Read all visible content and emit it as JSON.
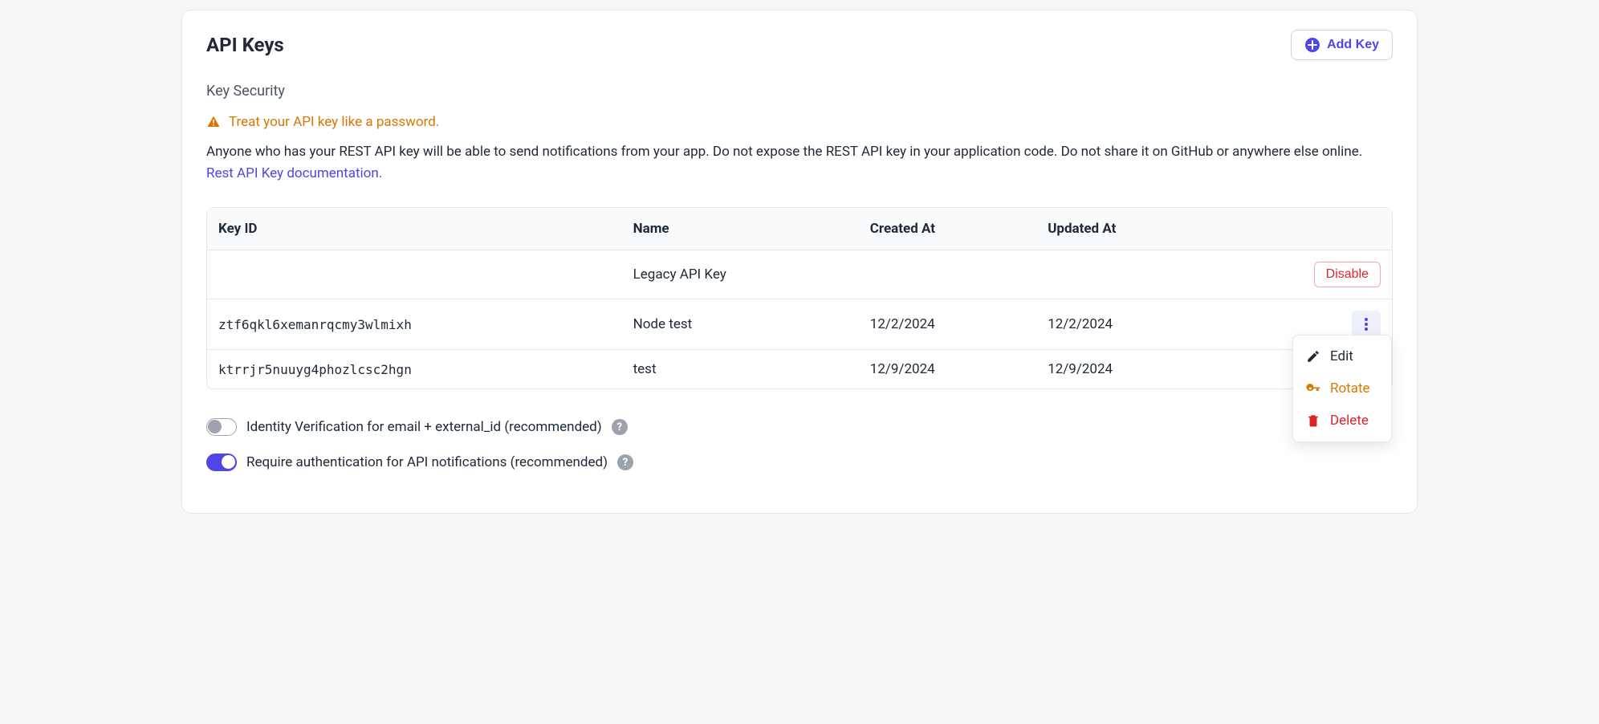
{
  "header": {
    "title": "API Keys",
    "add_key_label": "Add Key"
  },
  "security": {
    "heading": "Key Security",
    "warning": "Treat your API key like a password.",
    "description": "Anyone who has your REST API key will be able to send notifications from your app. Do not expose the REST API key in your application code. Do not share it on GitHub or anywhere else online. ",
    "doc_link_text": "Rest API Key documentation."
  },
  "table": {
    "columns": {
      "key_id": "Key ID",
      "name": "Name",
      "created_at": "Created At",
      "updated_at": "Updated At"
    },
    "rows": [
      {
        "key_id": "",
        "name": "Legacy API Key",
        "created_at": "",
        "updated_at": "",
        "action": "disable"
      },
      {
        "key_id": "ztf6qkl6xemanrqcmy3wlmixh",
        "name": "Node test",
        "created_at": "12/2/2024",
        "updated_at": "12/2/2024",
        "action": "menu-open"
      },
      {
        "key_id": "ktrrjr5nuuyg4phozlcsc2hgn",
        "name": "test",
        "created_at": "12/9/2024",
        "updated_at": "12/9/2024",
        "action": "menu"
      }
    ],
    "disable_label": "Disable",
    "menu": {
      "edit": "Edit",
      "rotate": "Rotate",
      "delete": "Delete"
    }
  },
  "toggles": {
    "identity": {
      "label": "Identity Verification for email + external_id (recommended)",
      "on": false
    },
    "auth": {
      "label": "Require authentication for API notifications (recommended)",
      "on": true
    }
  }
}
